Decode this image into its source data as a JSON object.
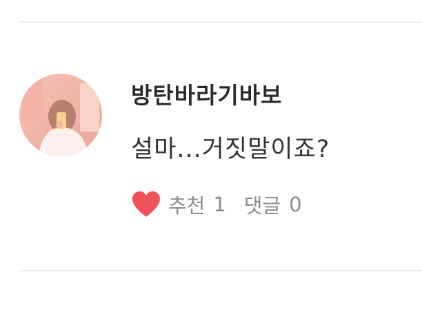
{
  "comment": {
    "author": "방탄바라기바보",
    "text": "설마...거짓말이죠?",
    "likes": {
      "label": "추천",
      "count": "1",
      "icon": "heart-icon",
      "icon_color": "#f0525a"
    },
    "replies": {
      "label": "댓글",
      "count": "0"
    }
  },
  "colors": {
    "divider": "#ececec",
    "author_text": "#2b2b2b",
    "meta_text": "#8c8c8c"
  }
}
